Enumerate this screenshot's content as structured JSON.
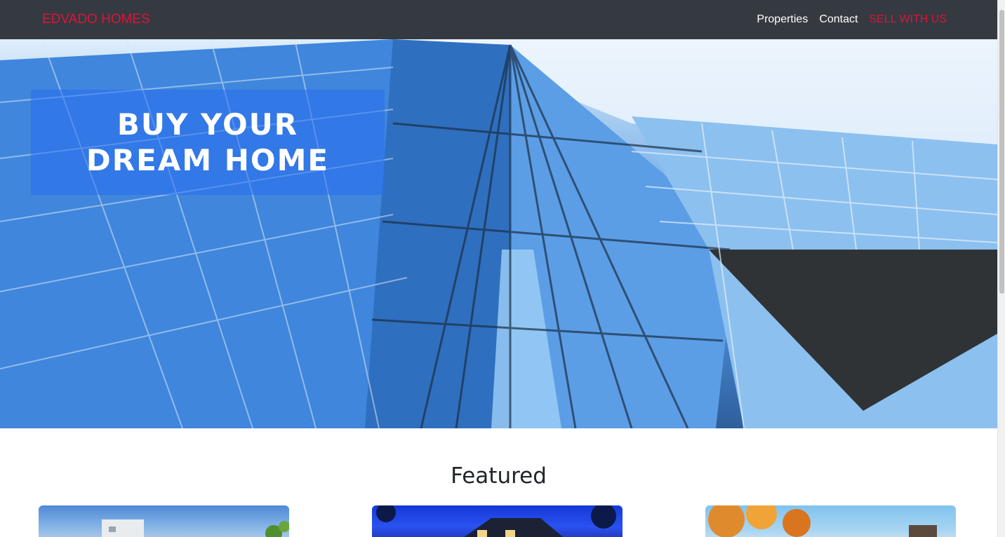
{
  "navbar": {
    "brand": "EDVADO HOMES",
    "links": [
      "Properties",
      "Contact",
      "SELL WITH US"
    ]
  },
  "hero": {
    "title": "BUY YOUR DREAM HOME"
  },
  "featured": {
    "heading": "Featured"
  },
  "colors": {
    "navbar_bg": "#343a40",
    "brand_accent": "#dc143c",
    "hero_overlay": "#286ef0"
  }
}
